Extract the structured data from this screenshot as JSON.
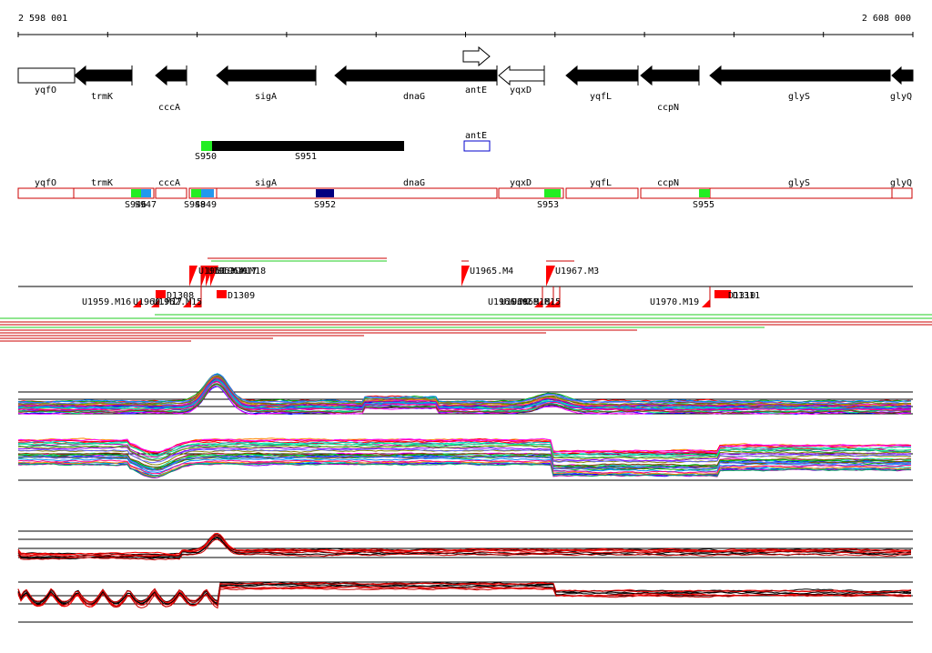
{
  "coordinates": {
    "start": "2 598 001",
    "end": "2 608 000"
  },
  "colors": {
    "gene_fill": "#000000",
    "segment_outline": "#cc0000",
    "probe_red": "#ff0000",
    "seg_green": "#22ee22",
    "seg_blue": "#2299ee",
    "seg_navy": "#000080",
    "antE_box": "#0000cc"
  },
  "genes": [
    {
      "name": "yqfO",
      "strand": "+",
      "filled": false,
      "start": 2598001,
      "end": 2598620
    },
    {
      "name": "trmK",
      "strand": "-",
      "filled": true,
      "start": 2598620,
      "end": 2599260
    },
    {
      "name": "cccA",
      "strand": "-",
      "filled": true,
      "start": 2599500,
      "end": 2599870
    },
    {
      "name": "sigA",
      "strand": "-",
      "filled": true,
      "start": 2600180,
      "end": 2601290
    },
    {
      "name": "dnaG",
      "strand": "-",
      "filled": true,
      "start": 2601500,
      "end": 2603300
    },
    {
      "name": "antE",
      "strand": "+",
      "filled": false,
      "start": 2602900,
      "end": 2603200
    },
    {
      "name": "yqxD",
      "strand": "-",
      "filled": false,
      "start": 2603300,
      "end": 2603820
    },
    {
      "name": "yqfL",
      "strand": "-",
      "filled": true,
      "start": 2604050,
      "end": 2604870
    },
    {
      "name": "ccpN",
      "strand": "-",
      "filled": true,
      "start": 2604880,
      "end": 2605530
    },
    {
      "name": "glyS",
      "strand": "-",
      "filled": true,
      "start": 2605630,
      "end": 2607760
    },
    {
      "name": "glyQ",
      "strand": "-",
      "filled": true,
      "start": 2607760,
      "end": 2608000
    }
  ],
  "antE_marker": {
    "label": "antE"
  },
  "segments_mid": [
    {
      "label": "S950",
      "color": "#22ee22"
    },
    {
      "label": "S951",
      "color": "#000000"
    }
  ],
  "segment_track": {
    "gene_labels": [
      "yqfO",
      "trmK",
      "cccA",
      "sigA",
      "dnaG",
      "yqxD",
      "yqfL",
      "ccpN",
      "glyS",
      "glyQ"
    ],
    "markers": [
      "S946",
      "S947",
      "S948",
      "S949",
      "S952",
      "S953",
      "S955"
    ]
  },
  "probes": {
    "upper_labels": [
      "U1961.M19",
      "U1963.M17",
      "U1964.M18",
      "U1965.M4",
      "U1967.M3"
    ],
    "lower_labels": [
      "U1959.M16",
      "U1960.M17",
      "U1962.M15",
      "U1966.M2",
      "U1968.M16",
      "U1969.M15",
      "U1970.M19"
    ],
    "dots": [
      "D1308",
      "D1309",
      "D1310",
      "D1311"
    ]
  }
}
